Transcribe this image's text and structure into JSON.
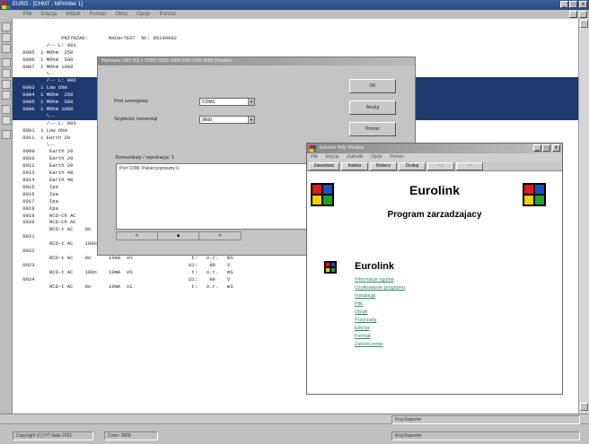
{
  "window": {
    "title": "EURO - [CHMT - MPrintter 1]",
    "menu": [
      "Plik",
      "Edycja",
      "Widok",
      "Pomiar",
      "Okno",
      "Opcje",
      "Pomoc"
    ],
    "controls": [
      "_",
      "□",
      "x"
    ]
  },
  "document": {
    "lines": [
      {
        "text": "              PRZYRZAD:       MACH+TEST  Nr: 95140002",
        "hl": false
      },
      {
        "text": "         /-- L: 001",
        "hl": false
      },
      {
        "text": " 0005  1 MOhm  250",
        "hl": false
      },
      {
        "text": " 0006  1 MOhm  500",
        "hl": false
      },
      {
        "text": " 0007  1 MOhm 1000",
        "hl": false
      },
      {
        "text": "         \\--",
        "hl": false
      },
      {
        "text": "         /-- L: 002",
        "hl": true
      },
      {
        "text": " 0003  1 Low Ohm",
        "hl": true
      },
      {
        "text": " 0004  1 MOhm  250",
        "hl": true
      },
      {
        "text": " 0005  1 MOhm  500",
        "hl": true
      },
      {
        "text": " 0006  1 MOhm 1000",
        "hl": true
      },
      {
        "text": "         \\--",
        "hl": true
      },
      {
        "text": "         /-- L: 003",
        "hl": false
      },
      {
        "text": " 0001  1 Low Ohm",
        "hl": false
      },
      {
        "text": " 0011  1 Earth 20",
        "hl": false
      },
      {
        "text": "         \\--",
        "hl": false
      },
      {
        "text": " 0009     Earth 20",
        "hl": false
      },
      {
        "text": " 0010     Earth 20",
        "hl": false
      },
      {
        "text": " 0012     Earth 20",
        "hl": false
      },
      {
        "text": " 0013     Earth 40",
        "hl": false
      },
      {
        "text": " 0014     Earth 40                                       I:  1.11    0",
        "hl": false
      },
      {
        "text": " 0015     Ipa                                            I:  1.081   0",
        "hl": false
      },
      {
        "text": " 0016     Ipa                                            I:   .729   0",
        "hl": false
      },
      {
        "text": " 0017     Ipa                                            I:   .781   0",
        "hl": false
      },
      {
        "text": " 0018     Ipa                                            I:  1.727   0",
        "hl": false
      },
      {
        "text": " 0019     RCD-Ch AC           10mA                       U1:    .0    V",
        "hl": false
      },
      {
        "text": " 0020     RCD-Ch AC           10mA                       U1:    .0    V",
        "hl": false
      },
      {
        "text": "          RCD-t AC    0o      10mA  x½                    t:   o.r.   mS",
        "hl": false
      },
      {
        "text": " 0021                                                    U1:    26    V",
        "hl": false
      },
      {
        "text": "          RCD-t AC    180o    10mA  x½                    t:   o.r.   mS",
        "hl": false
      },
      {
        "text": " 0022                                                    U1:    25    V",
        "hl": false
      },
      {
        "text": "          RCD-t AC    0o      10mA  x½                    t:   o.r.   mS",
        "hl": false
      },
      {
        "text": " 0023                                                    U1:    90    V",
        "hl": false
      },
      {
        "text": "          RCD-t AC    180o    10mA  x½                    t:   o.r.   mS",
        "hl": false
      },
      {
        "text": " 0024                                                    U1:    90    V",
        "hl": false
      },
      {
        "text": "          RCD-t AC    0o      10mA  x1                    t:   o.r.   mS",
        "hl": false
      }
    ]
  },
  "dialog": {
    "title": "Wymiana CMT 001 z CHMT 0055-2004 DVD-CPR 4000 (Polskie)",
    "port_label": "Port szeregowy",
    "port_value": "COM1",
    "speed_label": "Szybkosc transmisji",
    "speed_value": "9600",
    "ok_label": "OK",
    "cancel_label": "Anuluj",
    "help_label": "Pomoc",
    "status_label": "Komunikaty / rejestracja: 1",
    "status_text": "Port COM. Pakiet poprawny 0.",
    "nav": [
      "<",
      "■",
      ">"
    ]
  },
  "eurolink": {
    "title": "Eurolink Help Window",
    "controls": [
      "_",
      "□",
      "x"
    ],
    "menu": [
      "Plik",
      "Edycja",
      "Zakladki",
      "Opcje",
      "Pomoc"
    ],
    "toolbar": [
      "Zawartosc",
      "Indeks",
      "Wstecz",
      "Drukuj",
      "<<",
      ">>"
    ],
    "heading": "Eurolink",
    "subheading": "Program zarzadzajacy",
    "section": "Eurolink",
    "links": [
      "Informacje ogolne",
      "Uzytkowanie programu",
      "Instalacja",
      "Plik",
      "Opcje",
      "Przyrzady",
      "Edycja",
      "Format",
      "Zakonczenie"
    ],
    "logo_colors": {
      "tl": "#e01818",
      "tr": "#1a4ec8",
      "bl": "#f0d000",
      "br": "#20a030"
    }
  },
  "statusbar": {
    "copyright": "Copyright (C) HT Italia 2001",
    "conn": "Conn: 9600",
    "mode1": "Kraj Raporter",
    "mode2": "Kraj Raporter"
  }
}
